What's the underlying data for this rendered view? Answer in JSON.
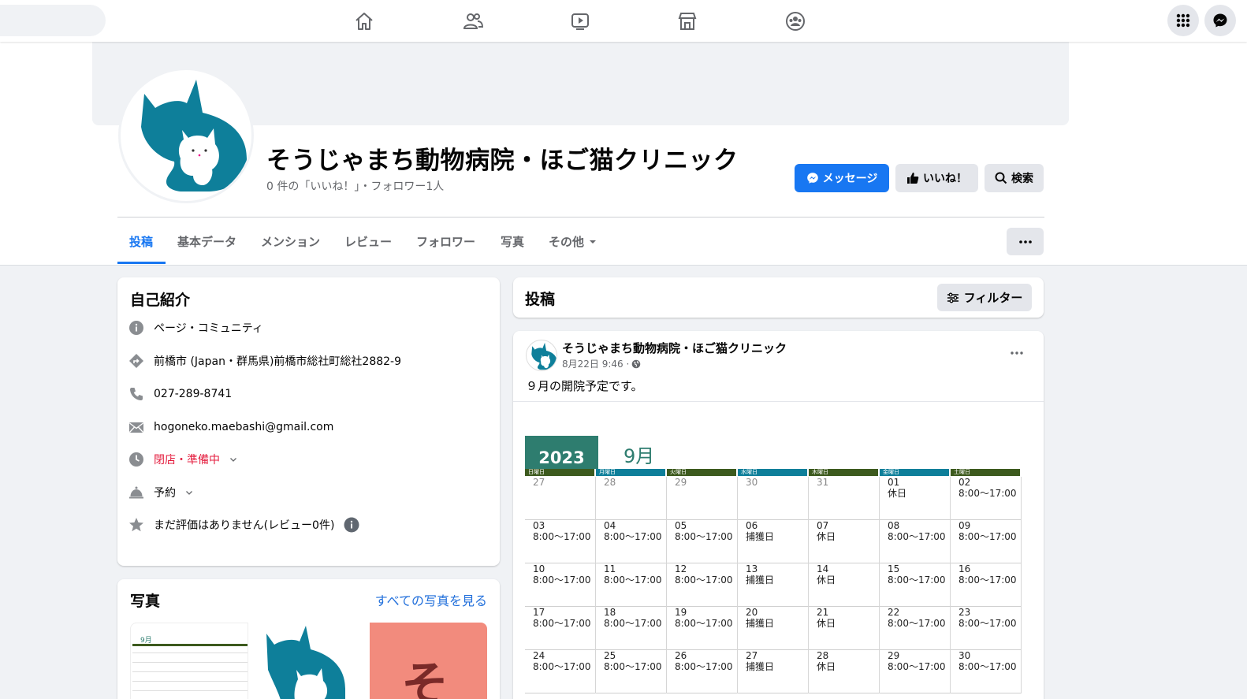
{
  "nav": {
    "icons": [
      "home-icon",
      "friends-icon",
      "watch-icon",
      "marketplace-icon",
      "groups-icon"
    ],
    "right_icons": [
      "apps-menu-icon",
      "messenger-icon"
    ]
  },
  "page": {
    "title": "そうじゃまち動物病院・ほご猫クリニック",
    "subtitle": "0 件の「いいね！」・フォロワー1人",
    "buttons": {
      "message": "メッセージ",
      "like": "いいね！",
      "search": "検索"
    }
  },
  "tabs": [
    {
      "label": "投稿",
      "active": true
    },
    {
      "label": "基本データ"
    },
    {
      "label": "メンション"
    },
    {
      "label": "レビュー"
    },
    {
      "label": "フォロワー"
    },
    {
      "label": "写真"
    },
    {
      "label": "その他"
    }
  ],
  "intro": {
    "title": "自己紹介",
    "category": "ページ・コミュニティ",
    "address": "前橋市 (Japan・群馬県)前橋市総社町総社2882-9",
    "phone": "027-289-8741",
    "email": "hogoneko.maebashi@gmail.com",
    "hours": "閉店・準備中",
    "reservation": "予約",
    "rating": "まだ評価はありません(レビュー0件)"
  },
  "photos": {
    "title": "写真",
    "see_all": "すべての写真を見る",
    "thumb_month": "9月",
    "thumb_char": "そ"
  },
  "posts_header": {
    "title": "投稿",
    "filter": "フィルター"
  },
  "post": {
    "author": "そうじゃまち動物病院・ほご猫クリニック",
    "date": "8月22日 9:46 ·",
    "text": "９月の開院予定です。",
    "calendar": {
      "year": "2023",
      "month": "9月",
      "weekdays": [
        "日曜日",
        "月曜日",
        "火曜日",
        "水曜日",
        "木曜日",
        "金曜日",
        "土曜日"
      ],
      "weeks": [
        [
          {
            "d": "27",
            "t": ""
          },
          {
            "d": "28",
            "t": ""
          },
          {
            "d": "29",
            "t": ""
          },
          {
            "d": "30",
            "t": ""
          },
          {
            "d": "31",
            "t": ""
          },
          {
            "d": "01",
            "t": "休日"
          },
          {
            "d": "02",
            "t": "8:00〜17:00"
          }
        ],
        [
          {
            "d": "03",
            "t": "8:00〜17:00"
          },
          {
            "d": "04",
            "t": "8:00〜17:00"
          },
          {
            "d": "05",
            "t": "8:00〜17:00"
          },
          {
            "d": "06",
            "t": "捕獲日"
          },
          {
            "d": "07",
            "t": "休日"
          },
          {
            "d": "08",
            "t": "8:00〜17:00"
          },
          {
            "d": "09",
            "t": "8:00〜17:00"
          }
        ],
        [
          {
            "d": "10",
            "t": "8:00〜17:00"
          },
          {
            "d": "11",
            "t": "8:00〜17:00"
          },
          {
            "d": "12",
            "t": "8:00〜17:00"
          },
          {
            "d": "13",
            "t": "捕獲日"
          },
          {
            "d": "14",
            "t": "休日"
          },
          {
            "d": "15",
            "t": "8:00〜17:00"
          },
          {
            "d": "16",
            "t": "8:00〜17:00"
          }
        ],
        [
          {
            "d": "17",
            "t": "8:00〜17:00"
          },
          {
            "d": "18",
            "t": "8:00〜17:00"
          },
          {
            "d": "19",
            "t": "8:00〜17:00"
          },
          {
            "d": "20",
            "t": "捕獲日"
          },
          {
            "d": "21",
            "t": "休日"
          },
          {
            "d": "22",
            "t": "8:00〜17:00"
          },
          {
            "d": "23",
            "t": "8:00〜17:00"
          }
        ],
        [
          {
            "d": "24",
            "t": "8:00〜17:00"
          },
          {
            "d": "25",
            "t": "8:00〜17:00"
          },
          {
            "d": "26",
            "t": "8:00〜17:00"
          },
          {
            "d": "27",
            "t": "捕獲日"
          },
          {
            "d": "28",
            "t": "休日"
          },
          {
            "d": "29",
            "t": "8:00〜17:00"
          },
          {
            "d": "30",
            "t": "8:00〜17:00"
          }
        ]
      ]
    }
  },
  "colors": {
    "accent": "#1877f2",
    "brand_teal": "#0e7f9a",
    "calendar_green": "#2e7d6f",
    "calendar_olive": "#3d5a1e",
    "closed_red": "#e41e3f"
  }
}
